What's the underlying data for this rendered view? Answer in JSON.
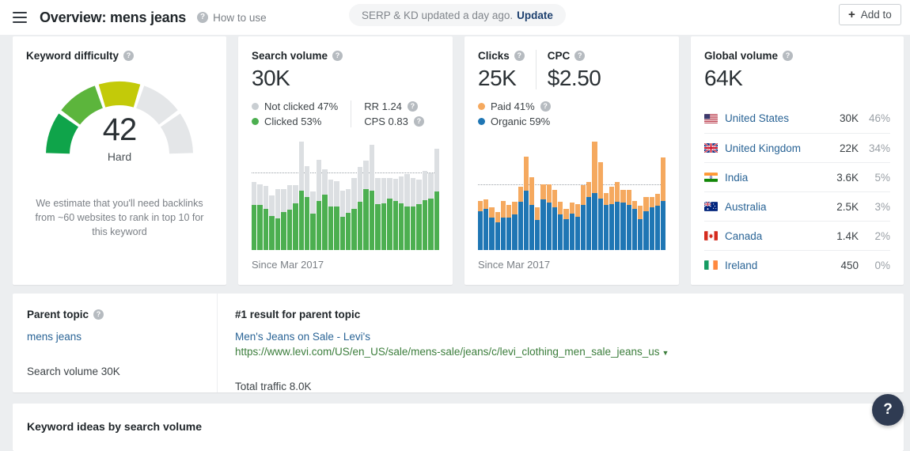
{
  "header": {
    "menu_icon": "hamburger-icon",
    "title": "Overview: mens jeans",
    "how_to_use": "How to use",
    "serp_notice": "SERP & KD updated a day ago.",
    "update_link": "Update",
    "add_to_label": "Add to",
    "plus": "+"
  },
  "keyword_difficulty": {
    "title": "Keyword difficulty",
    "value": "42",
    "label": "Hard",
    "note": "We estimate that you'll need backlinks from ~60 websites to rank in top 10 for this keyword",
    "gauge": {
      "segments": 5,
      "filled": 3,
      "colors": [
        "#0fa44a",
        "#5cb53c",
        "#c3ca09",
        "#e4e6e8",
        "#e4e6e8"
      ]
    }
  },
  "search_volume": {
    "title": "Search volume",
    "value": "30K",
    "legend": [
      {
        "label": "Not clicked 47%",
        "color": "#c9ced2"
      },
      {
        "label": "Clicked 53%",
        "color": "#4caf50"
      }
    ],
    "metrics": [
      {
        "label": "RR 1.24"
      },
      {
        "label": "CPS 0.83"
      }
    ],
    "since": "Since Mar 2017"
  },
  "clicks": {
    "title": "Clicks",
    "value": "25K",
    "cpc_title": "CPC",
    "cpc_value": "$2.50",
    "legend": [
      {
        "label": "Paid 41%",
        "color": "#f5a95f",
        "has_help": true
      },
      {
        "label": "Organic 59%",
        "color": "#1f76b4",
        "has_help": false
      }
    ],
    "since": "Since Mar 2017"
  },
  "global_volume": {
    "title": "Global volume",
    "value": "64K",
    "countries": [
      {
        "name": "United States",
        "flag": "us",
        "volume": "30K",
        "percent": "46%"
      },
      {
        "name": "United Kingdom",
        "flag": "gb",
        "volume": "22K",
        "percent": "34%"
      },
      {
        "name": "India",
        "flag": "in",
        "volume": "3.6K",
        "percent": "5%"
      },
      {
        "name": "Australia",
        "flag": "au",
        "volume": "2.5K",
        "percent": "3%"
      },
      {
        "name": "Canada",
        "flag": "ca",
        "volume": "1.4K",
        "percent": "2%"
      },
      {
        "name": "Ireland",
        "flag": "ie",
        "volume": "450",
        "percent": "0%"
      }
    ]
  },
  "parent_topic": {
    "title": "Parent topic",
    "keyword": "mens jeans",
    "search_volume": "Search volume 30K",
    "result_title": "#1 result for parent topic",
    "result_link": "Men's Jeans on Sale - Levi's",
    "result_url": "https://www.levi.com/US/en_US/sale/mens-sale/jeans/c/levi_clothing_men_sale_jeans_us",
    "total_traffic": "Total traffic 8.0K"
  },
  "bottom": {
    "title": "Keyword ideas by search volume"
  },
  "help_fab": {
    "label": "?"
  },
  "chart_data": [
    {
      "type": "bar",
      "id": "search-volume-chart",
      "stacked": true,
      "title": "Search volume history",
      "xlabel": "Since Mar 2017",
      "ylabel": "",
      "grid": false,
      "legend_position": "top",
      "avg_line": 0.72,
      "series": [
        {
          "name": "Clicked",
          "color": "#4caf50",
          "values": [
            0.42,
            0.42,
            0.39,
            0.32,
            0.3,
            0.36,
            0.38,
            0.44,
            0.56,
            0.5,
            0.34,
            0.46,
            0.52,
            0.41,
            0.41,
            0.31,
            0.35,
            0.39,
            0.45,
            0.57,
            0.56,
            0.43,
            0.44,
            0.48,
            0.46,
            0.44,
            0.41,
            0.41,
            0.43,
            0.47,
            0.48,
            0.55
          ]
        },
        {
          "name": "Not clicked",
          "color": "#dcdfe2",
          "values": [
            0.22,
            0.2,
            0.21,
            0.19,
            0.27,
            0.21,
            0.23,
            0.17,
            0.46,
            0.29,
            0.21,
            0.39,
            0.24,
            0.25,
            0.24,
            0.25,
            0.22,
            0.29,
            0.33,
            0.27,
            0.43,
            0.25,
            0.24,
            0.2,
            0.21,
            0.25,
            0.3,
            0.27,
            0.23,
            0.27,
            0.24,
            0.4
          ]
        }
      ]
    },
    {
      "type": "bar",
      "id": "clicks-chart",
      "stacked": true,
      "title": "Clicks history",
      "xlabel": "Since Mar 2017",
      "ylabel": "",
      "grid": false,
      "legend_position": "top",
      "avg_line": 0.6,
      "series": [
        {
          "name": "Organic",
          "color": "#1f76b4",
          "values": [
            0.36,
            0.38,
            0.3,
            0.26,
            0.3,
            0.3,
            0.33,
            0.45,
            0.55,
            0.42,
            0.28,
            0.47,
            0.44,
            0.4,
            0.33,
            0.29,
            0.34,
            0.31,
            0.42,
            0.49,
            0.53,
            0.48,
            0.42,
            0.43,
            0.45,
            0.44,
            0.42,
            0.38,
            0.29,
            0.36,
            0.4,
            0.41,
            0.46
          ]
        },
        {
          "name": "Paid",
          "color": "#f5a95f",
          "values": [
            0.1,
            0.09,
            0.1,
            0.09,
            0.16,
            0.12,
            0.12,
            0.14,
            0.32,
            0.26,
            0.12,
            0.14,
            0.17,
            0.16,
            0.12,
            0.09,
            0.1,
            0.12,
            0.18,
            0.14,
            0.48,
            0.34,
            0.11,
            0.16,
            0.18,
            0.12,
            0.14,
            0.08,
            0.12,
            0.13,
            0.09,
            0.11,
            0.4
          ]
        }
      ]
    }
  ]
}
